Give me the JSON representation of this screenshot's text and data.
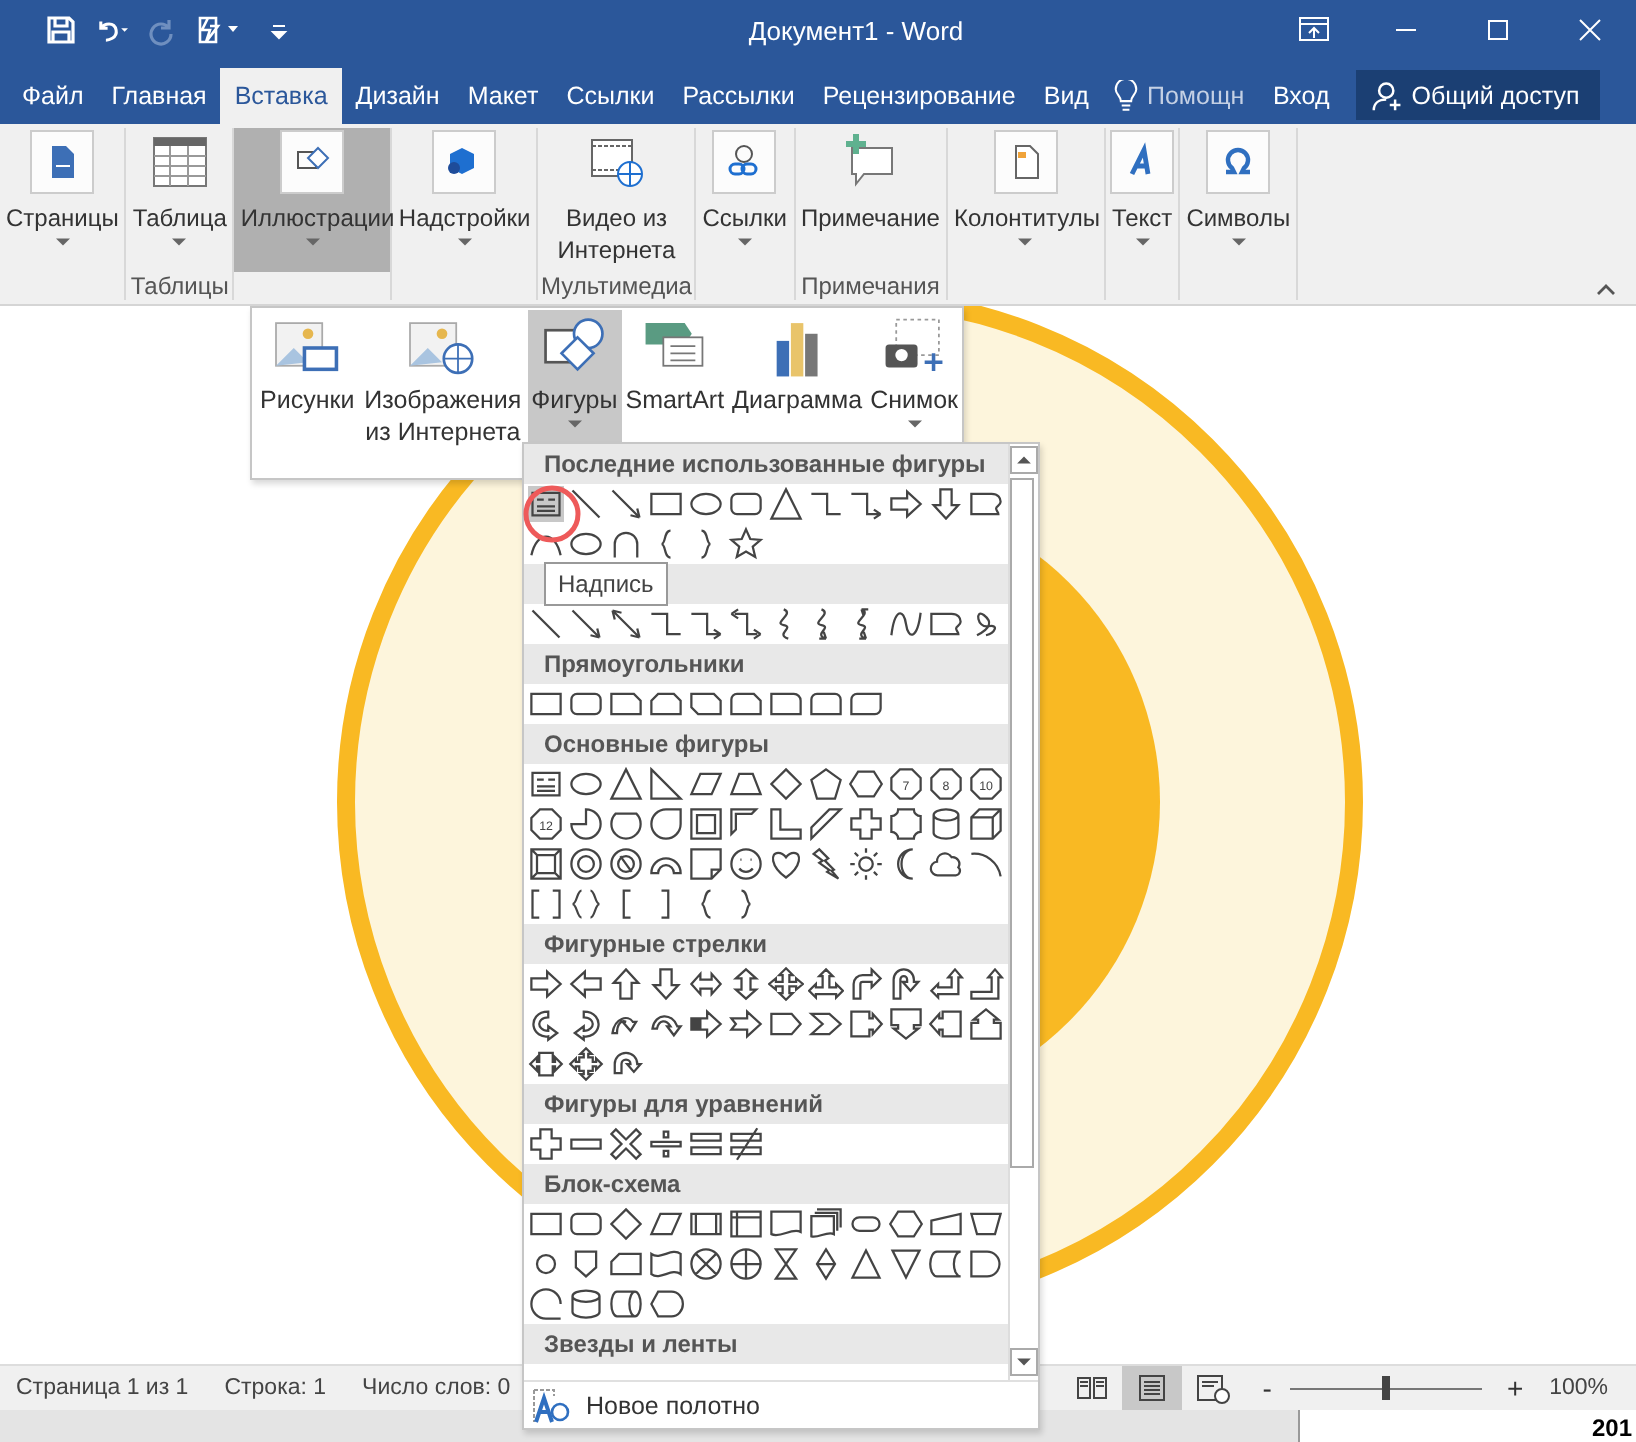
{
  "window": {
    "title": "Документ1 - Word"
  },
  "quick_access": [
    {
      "disabled": false
    },
    {
      "disabled": false
    },
    {
      "disabled": true
    },
    {
      "disabled": false
    }
  ],
  "tabs": [
    {
      "label": "Файл",
      "selected": false
    },
    {
      "label": "Главная",
      "selected": false
    },
    {
      "label": "Вставка",
      "selected": true
    },
    {
      "label": "Дизайн",
      "selected": false
    },
    {
      "label": "Макет",
      "selected": false
    },
    {
      "label": "Ссылки",
      "selected": false
    },
    {
      "label": "Рассылки",
      "selected": false
    },
    {
      "label": "Рецензирование",
      "selected": false
    },
    {
      "label": "Вид",
      "selected": false
    }
  ],
  "tell_me": {
    "placeholder": "Помощн"
  },
  "sign_in": "Вход",
  "share_button": "Общий доступ",
  "ribbon": {
    "groups": [
      {
        "buttons": [
          {
            "label": "Страницы",
            "caret": true,
            "selected": false
          }
        ]
      },
      {
        "buttons": [
          {
            "label": "Таблица",
            "caret": true,
            "selected": false
          }
        ],
        "label": "Таблицы"
      },
      {
        "buttons": [
          {
            "label": "Иллюстрации",
            "caret": true,
            "selected": true
          }
        ]
      },
      {
        "buttons": [
          {
            "label": "Надстройки",
            "caret": true,
            "selected": false
          }
        ]
      },
      {
        "buttons": [
          {
            "label": "Видео из Интернета",
            "caret": false,
            "selected": false
          }
        ],
        "label": "Мультимедиа"
      },
      {
        "buttons": [
          {
            "label": "Ссылки",
            "caret": true,
            "selected": false
          }
        ]
      },
      {
        "buttons": [
          {
            "label": "Примечание",
            "caret": false,
            "selected": false
          }
        ],
        "label": "Примечания"
      },
      {
        "buttons": [
          {
            "label": "Колонтитулы",
            "caret": true,
            "selected": false
          }
        ]
      },
      {
        "buttons": [
          {
            "label": "Текст",
            "caret": true,
            "selected": false
          }
        ]
      },
      {
        "buttons": [
          {
            "label": "Символы",
            "caret": true,
            "selected": false
          }
        ]
      }
    ]
  },
  "illustrations_menu": [
    {
      "label": "Рисунки",
      "caret": false,
      "selected": false
    },
    {
      "label": "Изображения из Интернета",
      "caret": false,
      "selected": false
    },
    {
      "label": "Фигуры",
      "caret": true,
      "selected": true
    },
    {
      "label": "SmartArt",
      "caret": false,
      "selected": false
    },
    {
      "label": "Диаграмма",
      "caret": false,
      "selected": false
    },
    {
      "label": "Снимок",
      "caret": true,
      "selected": false
    }
  ],
  "shapes_gallery": {
    "sections": [
      {
        "title": "Последние использованные фигуры",
        "rows": [
          [
            {
              "kind": "textbox",
              "selected": true
            },
            {
              "kind": "line",
              "selected": false
            },
            {
              "kind": "arrow-line",
              "selected": false
            },
            {
              "kind": "rect",
              "selected": false
            },
            {
              "kind": "oval",
              "selected": false
            },
            {
              "kind": "rounded-rect",
              "selected": false
            },
            {
              "kind": "triangle",
              "selected": false
            },
            {
              "kind": "elbow",
              "selected": false
            },
            {
              "kind": "elbow-arrow",
              "selected": false
            },
            {
              "kind": "arrow-right",
              "selected": false
            },
            {
              "kind": "arrow-down",
              "selected": false
            },
            {
              "kind": "freeform-shape",
              "selected": false
            }
          ],
          [
            {
              "kind": "curve",
              "selected": false
            },
            {
              "kind": "oval",
              "selected": false
            },
            {
              "kind": "arch",
              "selected": false
            },
            {
              "kind": "brace-left",
              "selected": false
            },
            {
              "kind": "brace-right",
              "selected": false
            },
            {
              "kind": "star",
              "selected": false
            }
          ]
        ]
      },
      {
        "rows": [
          [
            {
              "kind": "line"
            },
            {
              "kind": "arrow-line"
            },
            {
              "kind": "double-arrow-line"
            },
            {
              "kind": "elbow"
            },
            {
              "kind": "elbow-arrow"
            },
            {
              "kind": "elbow-double-arrow"
            },
            {
              "kind": "curve-s"
            },
            {
              "kind": "curve-arrow"
            },
            {
              "kind": "curve-double-arrow"
            },
            {
              "kind": "freeform-line"
            },
            {
              "kind": "freeform-shape"
            },
            {
              "kind": "scribble"
            }
          ]
        ]
      },
      {
        "title": "Прямоугольники",
        "rows": [
          [
            {
              "kind": "rect"
            },
            {
              "kind": "rounded-rect"
            },
            {
              "kind": "snip-rect"
            },
            {
              "kind": "snip2-rect"
            },
            {
              "kind": "snip-diag-rect"
            },
            {
              "kind": "round-snip-rect"
            },
            {
              "kind": "round1-rect"
            },
            {
              "kind": "round2-rect"
            },
            {
              "kind": "round-diag-rect"
            }
          ]
        ]
      },
      {
        "title": "Основные фигуры",
        "rows": [
          [
            {
              "kind": "textbox"
            },
            {
              "kind": "oval"
            },
            {
              "kind": "triangle"
            },
            {
              "kind": "right-triangle"
            },
            {
              "kind": "parallelogram"
            },
            {
              "kind": "trapezoid"
            },
            {
              "kind": "diamond"
            },
            {
              "kind": "pentagon"
            },
            {
              "kind": "hexagon"
            },
            {
              "kind": "polygon",
              "label": "7"
            },
            {
              "kind": "polygon",
              "label": "8"
            },
            {
              "kind": "polygon",
              "label": "10"
            }
          ],
          [
            {
              "kind": "polygon",
              "label": "12"
            },
            {
              "kind": "pie"
            },
            {
              "kind": "chord"
            },
            {
              "kind": "teardrop"
            },
            {
              "kind": "frame"
            },
            {
              "kind": "half-frame"
            },
            {
              "kind": "l-shape"
            },
            {
              "kind": "diagonal-stripe"
            },
            {
              "kind": "cross"
            },
            {
              "kind": "plaque"
            },
            {
              "kind": "can"
            },
            {
              "kind": "cube"
            }
          ],
          [
            {
              "kind": "bevel"
            },
            {
              "kind": "donut"
            },
            {
              "kind": "no-symbol"
            },
            {
              "kind": "block-arc"
            },
            {
              "kind": "folded-corner"
            },
            {
              "kind": "smiley"
            },
            {
              "kind": "heart"
            },
            {
              "kind": "lightning"
            },
            {
              "kind": "sun"
            },
            {
              "kind": "moon"
            },
            {
              "kind": "cloud"
            },
            {
              "kind": "arc"
            }
          ],
          [
            {
              "kind": "bracket-pair"
            },
            {
              "kind": "brace-pair"
            },
            {
              "kind": "bracket-left"
            },
            {
              "kind": "bracket-right"
            },
            {
              "kind": "brace-left"
            },
            {
              "kind": "brace-right"
            }
          ]
        ]
      },
      {
        "title": "Фигурные стрелки",
        "rows": [
          [
            {
              "kind": "arrow-right"
            },
            {
              "kind": "arrow-left"
            },
            {
              "kind": "arrow-up"
            },
            {
              "kind": "arrow-down"
            },
            {
              "kind": "arrow-left-right"
            },
            {
              "kind": "arrow-up-down"
            },
            {
              "kind": "arrow-quad"
            },
            {
              "kind": "arrow-left-right-up"
            },
            {
              "kind": "arrow-bent"
            },
            {
              "kind": "arrow-u-turn"
            },
            {
              "kind": "arrow-left-up"
            },
            {
              "kind": "arrow-bent-up"
            }
          ],
          [
            {
              "kind": "arrow-curved-right"
            },
            {
              "kind": "arrow-curved-left"
            },
            {
              "kind": "arrow-curved-up"
            },
            {
              "kind": "arrow-curved-down"
            },
            {
              "kind": "arrow-striped"
            },
            {
              "kind": "arrow-notched"
            },
            {
              "kind": "home-plate"
            },
            {
              "kind": "chevron"
            },
            {
              "kind": "callout-right"
            },
            {
              "kind": "callout-down"
            },
            {
              "kind": "callout-left"
            },
            {
              "kind": "callout-up"
            }
          ],
          [
            {
              "kind": "callout-left-right"
            },
            {
              "kind": "callout-quad"
            },
            {
              "kind": "arrow-circular"
            }
          ]
        ]
      },
      {
        "title": "Фигуры для уравнений",
        "rows": [
          [
            {
              "kind": "cross"
            },
            {
              "kind": "minus"
            },
            {
              "kind": "multiply"
            },
            {
              "kind": "divide"
            },
            {
              "kind": "equal"
            },
            {
              "kind": "not-equal"
            }
          ]
        ]
      },
      {
        "title": "Блок-схема",
        "rows": [
          [
            {
              "kind": "rect"
            },
            {
              "kind": "rounded-rect"
            },
            {
              "kind": "diamond"
            },
            {
              "kind": "parallelogram"
            },
            {
              "kind": "predefined-process"
            },
            {
              "kind": "internal-storage"
            },
            {
              "kind": "document"
            },
            {
              "kind": "multidocument"
            },
            {
              "kind": "terminator"
            },
            {
              "kind": "hexagon"
            },
            {
              "kind": "manual-input"
            },
            {
              "kind": "manual-operation"
            }
          ],
          [
            {
              "kind": "connector"
            },
            {
              "kind": "offpage-connector"
            },
            {
              "kind": "card"
            },
            {
              "kind": "punched-tape"
            },
            {
              "kind": "summing-junction"
            },
            {
              "kind": "or"
            },
            {
              "kind": "collate"
            },
            {
              "kind": "sort"
            },
            {
              "kind": "extract"
            },
            {
              "kind": "merge"
            },
            {
              "kind": "stored-data"
            },
            {
              "kind": "delay"
            }
          ],
          [
            {
              "kind": "sequential-storage"
            },
            {
              "kind": "magnetic-disk"
            },
            {
              "kind": "direct-access-storage"
            },
            {
              "kind": "display"
            }
          ]
        ]
      },
      {
        "title": "Звезды и ленты"
      }
    ],
    "tooltip": "Надпись",
    "footer": "Новое полотно"
  },
  "status_bar": {
    "items": [
      "Страница 1 из 1",
      "Строка: 1",
      "Число слов: 0"
    ],
    "views": [
      {
        "selected": false
      },
      {
        "selected": true
      },
      {
        "selected": false
      }
    ],
    "zoom_out": "-",
    "zoom_in": "+",
    "zoom": {
      "level": 0.5
    },
    "zoom_label": "100%"
  },
  "background_window": {
    "text": "201"
  }
}
